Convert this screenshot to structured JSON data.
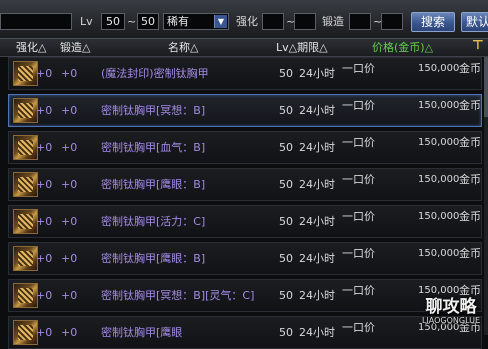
{
  "filter": {
    "lv_label": "Lv",
    "lv_min": "50",
    "lv_tilde": "~",
    "lv_max": "50",
    "rarity": "稀有",
    "strengthen_label": "强化",
    "strengthen_tilde": "~",
    "forge_label": "锻造",
    "forge_tilde": "~",
    "search_label": "搜索",
    "default_label": "默认"
  },
  "header": {
    "strengthen": "强化△",
    "forge": "锻造△",
    "name": "名称△",
    "lv_time": "Lv△期限△",
    "price": "价格(金币)△",
    "sort_icon": "pin-sort-icon"
  },
  "rows": [
    {
      "str": "+0",
      "forge": "+0",
      "name": "(魔法封印)密制钛胸甲",
      "lv": "50",
      "time": "24小时",
      "buy": "一口价",
      "price": "150,000",
      "cur": "金币"
    },
    {
      "str": "+0",
      "forge": "+0",
      "name": "密制钛胸甲[冥想：B]",
      "lv": "50",
      "time": "24小时",
      "buy": "一口价",
      "price": "150,000",
      "cur": "金币"
    },
    {
      "str": "+0",
      "forge": "+0",
      "name": "密制钛胸甲[血气：B]",
      "lv": "50",
      "time": "24小时",
      "buy": "一口价",
      "price": "150,000",
      "cur": "金币"
    },
    {
      "str": "+0",
      "forge": "+0",
      "name": "密制钛胸甲[鹰眼：B]",
      "lv": "50",
      "time": "24小时",
      "buy": "一口价",
      "price": "150,000",
      "cur": "金币"
    },
    {
      "str": "+0",
      "forge": "+0",
      "name": "密制钛胸甲[活力：C]",
      "lv": "50",
      "time": "24小时",
      "buy": "一口价",
      "price": "150,000",
      "cur": "金币"
    },
    {
      "str": "+0",
      "forge": "+0",
      "name": "密制钛胸甲[鹰眼：B]",
      "lv": "50",
      "time": "24小时",
      "buy": "一口价",
      "price": "150,000",
      "cur": "金币"
    },
    {
      "str": "+0",
      "forge": "+0",
      "name": "密制钛胸甲[冥想：B][灵气：C]",
      "lv": "50",
      "time": "24小时",
      "buy": "一口价",
      "price": "150,000",
      "cur": "金币"
    },
    {
      "str": "+0",
      "forge": "+0",
      "name": "密制钛胸甲[鹰眼",
      "lv": "50",
      "time": "24小时",
      "buy": "一口价",
      "price": "150,000",
      "cur": "金币"
    }
  ],
  "selected_row": 1,
  "watermark": {
    "main": "聊攻略",
    "sub": "LIAOGONGLUE"
  },
  "colors": {
    "item_name": "#a48ae6",
    "price_header": "#62d24a",
    "selected_border": "#4d72b6",
    "button": "#3a5690"
  }
}
